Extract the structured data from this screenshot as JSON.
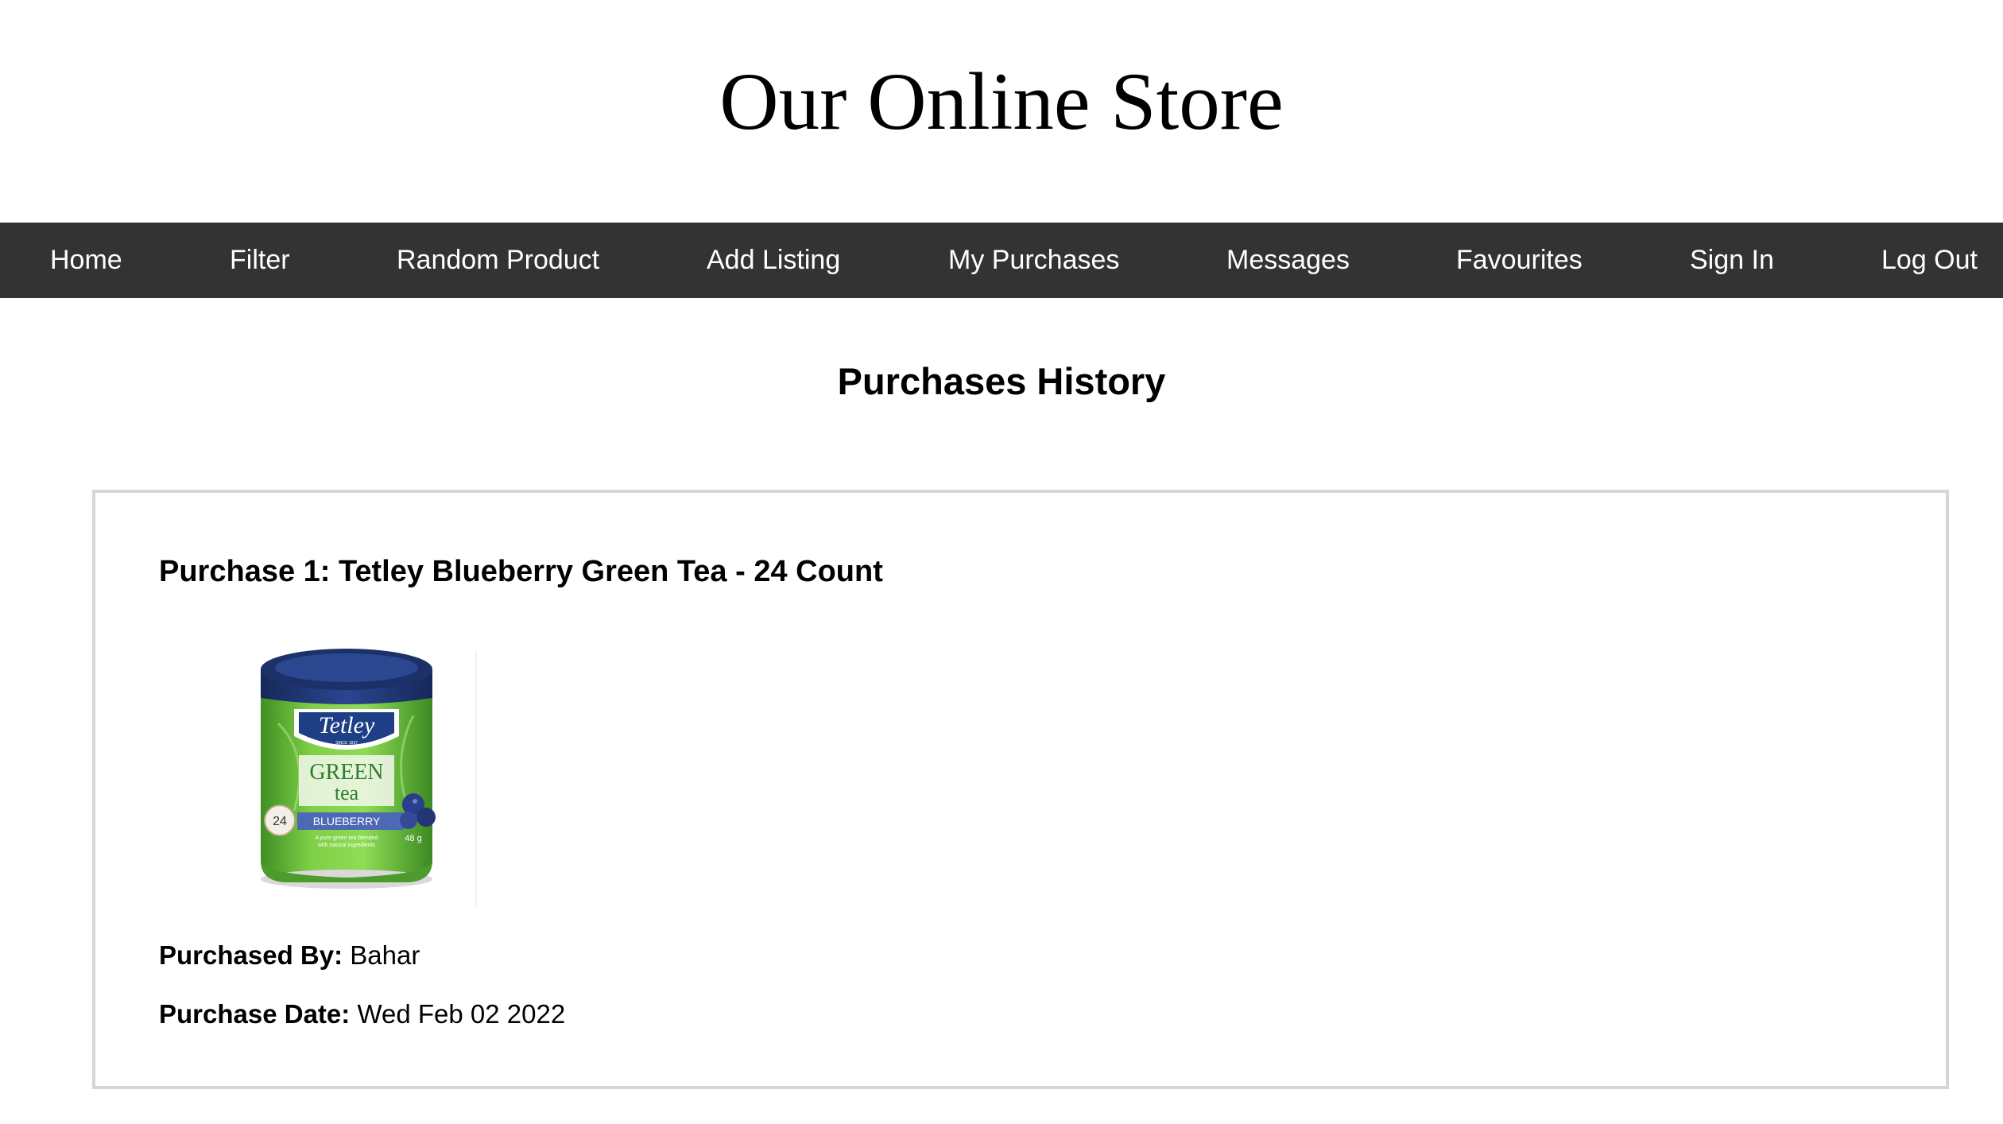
{
  "header": {
    "title": "Our Online Store"
  },
  "nav": {
    "items": [
      {
        "label": "Home"
      },
      {
        "label": "Filter"
      },
      {
        "label": "Random Product"
      },
      {
        "label": "Add Listing"
      },
      {
        "label": "My Purchases"
      },
      {
        "label": "Messages"
      },
      {
        "label": "Favourites"
      },
      {
        "label": "Sign In"
      },
      {
        "label": "Log Out"
      }
    ]
  },
  "main": {
    "heading": "Purchases History",
    "purchases": [
      {
        "title": "Purchase 1: Tetley Blueberry Green Tea - 24 Count",
        "image": {
          "brand": "Tetley",
          "since": "SINCE 1837",
          "product_line_1": "GREEN",
          "product_line_2": "tea",
          "flavour": "BLUEBERRY",
          "count": "24",
          "weight": "48 g",
          "tagline_1": "A pure green tea blended",
          "tagline_2": "with natural ingredients"
        },
        "purchased_by_label": "Purchased By:",
        "purchased_by": "Bahar",
        "purchase_date_label": "Purchase Date:",
        "purchase_date": "Wed Feb 02 2022"
      }
    ]
  },
  "colors": {
    "nav_background": "#333333",
    "nav_text": "#ffffff",
    "card_border": "#d6d6d6",
    "tin_lid": "#1f3670",
    "tin_green": "#6cbd3a",
    "tin_label_blue": "#4d68b5"
  }
}
